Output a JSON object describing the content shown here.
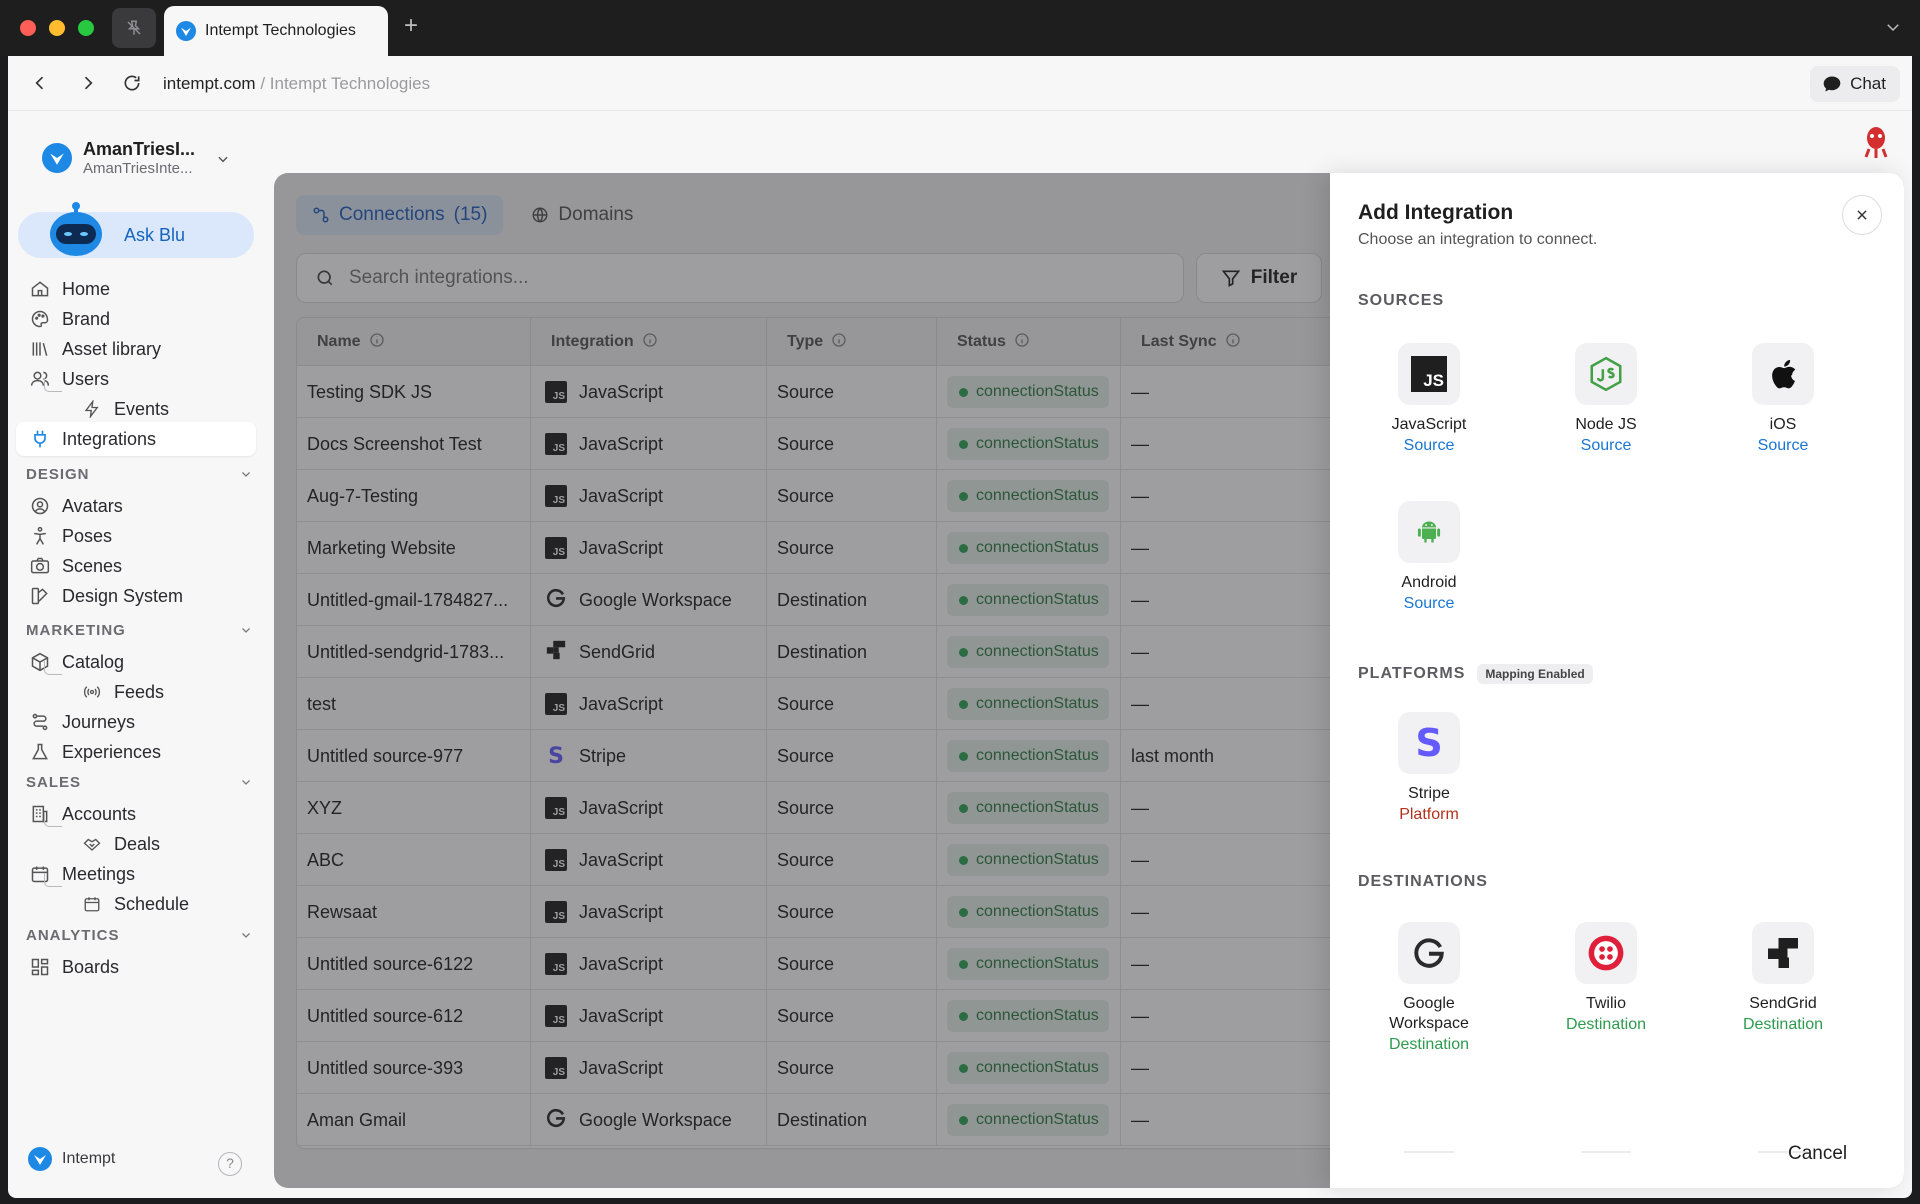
{
  "browser": {
    "tab_title": "Intempt Technologies",
    "url_host": "intempt.com",
    "url_sep": " / ",
    "url_page": "Intempt Technologies",
    "chat_label": "Chat"
  },
  "sidebar": {
    "workspace_name": "AmanTriesI...",
    "workspace_sub": "AmanTriesInte...",
    "ask_label": "Ask Blu",
    "items": [
      {
        "label": "Home",
        "icon": "home-icon"
      },
      {
        "label": "Brand",
        "icon": "palette-icon"
      },
      {
        "label": "Asset library",
        "icon": "library-icon"
      },
      {
        "label": "Users",
        "icon": "users-icon"
      },
      {
        "label": "Events",
        "icon": "bolt-icon"
      },
      {
        "label": "Integrations",
        "icon": "plug-icon"
      }
    ],
    "design": {
      "title": "DESIGN",
      "items": [
        {
          "label": "Avatars",
          "icon": "avatar-icon"
        },
        {
          "label": "Poses",
          "icon": "pose-icon"
        },
        {
          "label": "Scenes",
          "icon": "camera-icon"
        },
        {
          "label": "Design System",
          "icon": "design-system-icon"
        }
      ]
    },
    "marketing": {
      "title": "MARKETING",
      "items": [
        {
          "label": "Catalog",
          "icon": "box-icon"
        },
        {
          "label": "Feeds",
          "icon": "broadcast-icon"
        },
        {
          "label": "Journeys",
          "icon": "route-icon"
        },
        {
          "label": "Experiences",
          "icon": "flask-icon"
        }
      ]
    },
    "sales": {
      "title": "SALES",
      "items": [
        {
          "label": "Accounts",
          "icon": "building-icon"
        },
        {
          "label": "Deals",
          "icon": "handshake-icon"
        },
        {
          "label": "Meetings",
          "icon": "calendar-icon"
        },
        {
          "label": "Schedule",
          "icon": "calendar-icon"
        }
      ]
    },
    "analytics": {
      "title": "ANALYTICS",
      "items": [
        {
          "label": "Boards",
          "icon": "grid-icon"
        }
      ]
    },
    "footer_label": "Intempt",
    "help_label": "?"
  },
  "main": {
    "tabs": [
      {
        "label": "Connections",
        "count": "(15)"
      },
      {
        "label": "Domains"
      }
    ],
    "search_placeholder": "Search integrations...",
    "filter_label": "Filter",
    "columns": [
      "Name",
      "Integration",
      "Type",
      "Status",
      "Last Sync"
    ],
    "rows": [
      {
        "name": "Testing SDK JS",
        "integration": "JavaScript",
        "icon": "js",
        "type": "Source",
        "status": "connectionStatus",
        "last_sync": "—"
      },
      {
        "name": "Docs Screenshot Test",
        "integration": "JavaScript",
        "icon": "js",
        "type": "Source",
        "status": "connectionStatus",
        "last_sync": "—"
      },
      {
        "name": "Aug-7-Testing",
        "integration": "JavaScript",
        "icon": "js",
        "type": "Source",
        "status": "connectionStatus",
        "last_sync": "—"
      },
      {
        "name": "Marketing Website",
        "integration": "JavaScript",
        "icon": "js",
        "type": "Source",
        "status": "connectionStatus",
        "last_sync": "—"
      },
      {
        "name": "Untitled-gmail-1784827...",
        "integration": "Google Workspace",
        "icon": "google",
        "type": "Destination",
        "status": "connectionStatus",
        "last_sync": "—"
      },
      {
        "name": "Untitled-sendgrid-1783...",
        "integration": "SendGrid",
        "icon": "sendgrid",
        "type": "Destination",
        "status": "connectionStatus",
        "last_sync": "—"
      },
      {
        "name": "test",
        "integration": "JavaScript",
        "icon": "js",
        "type": "Source",
        "status": "connectionStatus",
        "last_sync": "—"
      },
      {
        "name": "Untitled source-977",
        "integration": "Stripe",
        "icon": "stripe",
        "type": "Source",
        "status": "connectionStatus",
        "last_sync": "last month"
      },
      {
        "name": "XYZ",
        "integration": "JavaScript",
        "icon": "js",
        "type": "Source",
        "status": "connectionStatus",
        "last_sync": "—"
      },
      {
        "name": "ABC",
        "integration": "JavaScript",
        "icon": "js",
        "type": "Source",
        "status": "connectionStatus",
        "last_sync": "—"
      },
      {
        "name": "Rewsaat",
        "integration": "JavaScript",
        "icon": "js",
        "type": "Source",
        "status": "connectionStatus",
        "last_sync": "—"
      },
      {
        "name": "Untitled source-6122",
        "integration": "JavaScript",
        "icon": "js",
        "type": "Source",
        "status": "connectionStatus",
        "last_sync": "—"
      },
      {
        "name": "Untitled source-612",
        "integration": "JavaScript",
        "icon": "js",
        "type": "Source",
        "status": "connectionStatus",
        "last_sync": "—"
      },
      {
        "name": "Untitled source-393",
        "integration": "JavaScript",
        "icon": "js",
        "type": "Source",
        "status": "connectionStatus",
        "last_sync": "—"
      },
      {
        "name": "Aman Gmail",
        "integration": "Google Workspace",
        "icon": "google",
        "type": "Destination",
        "status": "connectionStatus",
        "last_sync": "—"
      }
    ]
  },
  "drawer": {
    "title": "Add Integration",
    "subtitle": "Choose an integration to connect.",
    "sources_title": "SOURCES",
    "platforms_title": "PLATFORMS",
    "platforms_badge": "Mapping Enabled",
    "destinations_title": "DESTINATIONS",
    "sources": [
      {
        "name": "JavaScript",
        "kind": "Source",
        "icon": "javascript-icon"
      },
      {
        "name": "Node JS",
        "kind": "Source",
        "icon": "nodejs-icon"
      },
      {
        "name": "iOS",
        "kind": "Source",
        "icon": "apple-icon"
      },
      {
        "name": "Android",
        "kind": "Source",
        "icon": "android-icon"
      }
    ],
    "platforms": [
      {
        "name": "Stripe",
        "kind": "Platform",
        "icon": "stripe-icon"
      }
    ],
    "destinations": [
      {
        "name": "Google\nWorkspace",
        "kind": "Destination",
        "icon": "google-icon"
      },
      {
        "name": "Twilio",
        "kind": "Destination",
        "icon": "twilio-icon"
      },
      {
        "name": "SendGrid",
        "kind": "Destination",
        "icon": "sendgrid-icon"
      }
    ],
    "cancel_label": "Cancel"
  },
  "colors": {
    "accent": "#1e88e5",
    "status_green": "#2fa556",
    "platform_red": "#b3321c"
  }
}
